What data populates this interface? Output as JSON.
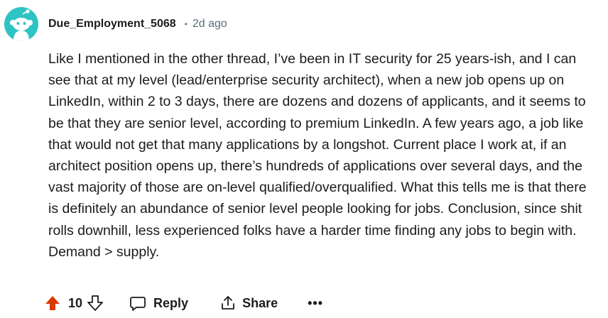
{
  "comment": {
    "username": "Due_Employment_5068",
    "separator": "•",
    "timestamp": "2d ago",
    "body": "Like I mentioned in the other thread, I’ve been in IT security for 25 years-ish, and I can see that at my level (lead/enterprise security architect), when a new job opens up on LinkedIn, within 2 to 3 days, there are dozens and dozens of applicants, and it seems to be that they are senior level, according to premium LinkedIn. A few years ago, a job like that would not get that many applications by a longshot. Current place I work at, if an architect position opens up, there’s hundreds of applications over several days, and the vast majority of those are on-level qualified/overqualified. What this tells me is that there is definitely an abundance of senior level people looking for jobs. Conclusion, since shit rolls downhill, less experienced folks have a harder time finding any jobs to begin with. Demand > supply.",
    "avatar_color": "#2ec4c4"
  },
  "actions": {
    "upvote_icon": "upvote-arrow-icon",
    "upvote_color": "#d93a00",
    "score": "10",
    "downvote_icon": "downvote-arrow-icon",
    "reply_icon": "speech-bubble-icon",
    "reply_label": "Reply",
    "share_icon": "share-icon",
    "share_label": "Share",
    "more_label": "•••"
  }
}
